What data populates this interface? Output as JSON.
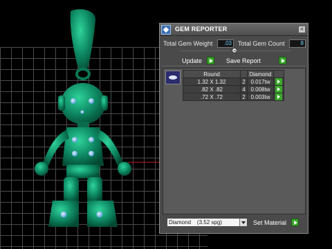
{
  "window": {
    "title": "GEM REPORTER",
    "close_glyph": "×"
  },
  "summary": {
    "weight_label": "Total Gem Weight",
    "weight_value": ".03",
    "count_label": "Total Gem Count",
    "count_value": "8"
  },
  "toolbar": {
    "update_label": "Update",
    "save_label": "Save Report"
  },
  "table": {
    "headers": [
      "Round",
      "",
      "Diamond",
      ""
    ],
    "rows": [
      {
        "size": "1.32 X 1.32",
        "count": "2",
        "weight": "0.017tw"
      },
      {
        "size": ".82 X .82",
        "count": "4",
        "weight": "0.008tw"
      },
      {
        "size": ".72 X .72",
        "count": "2",
        "weight": "0.003tw"
      }
    ]
  },
  "material": {
    "selected": "Diamond    (3.52 spg)",
    "set_label": "Set Material"
  },
  "colors": {
    "figure": "#0e8a64",
    "panel": "#4a4a4a",
    "accent_green": "#3aa72a",
    "value_text": "#6fd0ff"
  }
}
